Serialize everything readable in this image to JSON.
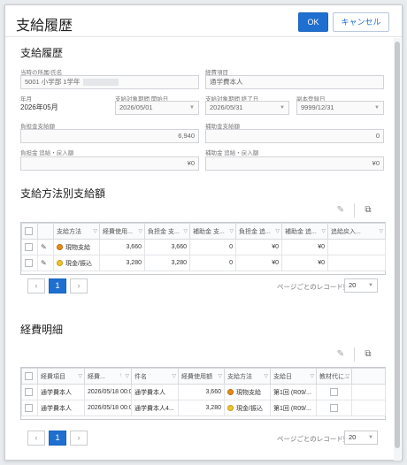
{
  "header": {
    "title": "支給履歴",
    "ok_label": "OK",
    "cancel_label": "キャンセル"
  },
  "summary": {
    "title": "支給履歴",
    "org_label": "当時の所属/氏名",
    "org_value": "5001 小学部 1学年",
    "expense_label": "経費項目",
    "expense_value": "通学費本人",
    "ym_label": "年月",
    "ym_value": "2026年05月",
    "start_label": "支給対象期間 開始日",
    "start_value": "2026/05/01",
    "end_label": "支給対象期間 終了日",
    "end_value": "2026/05/31",
    "revoke_label": "副本登録日",
    "revoke_value": "9999/12/31",
    "burden_label": "負担金支給額",
    "burden_value": "6,940",
    "subsidy_label": "補助金支給額",
    "subsidy_value": "0",
    "burden_refund_label": "負担金 追給・戻入額",
    "burden_refund_value": "¥0",
    "subsidy_refund_label": "補助金 追給・戻入額",
    "subsidy_refund_value": "¥0"
  },
  "methods": {
    "title": "支給方法別支給額",
    "columns": [
      "支給方法",
      "経費使用...",
      "負担金 支...",
      "補助金 支...",
      "負担金 追...",
      "補助金 追...",
      "追給戻入..."
    ],
    "rows": [
      {
        "method": "現物支給",
        "used": "3,660",
        "burden": "3,660",
        "subsidy": "0",
        "burden_ref": "¥0",
        "subsidy_ref": "¥0",
        "extra": ""
      },
      {
        "method": "現金/振込",
        "used": "3,280",
        "burden": "3,280",
        "subsidy": "0",
        "burden_ref": "¥0",
        "subsidy_ref": "¥0",
        "extra": ""
      }
    ],
    "pager": {
      "page": "1",
      "label": "ページごとのレコード数",
      "size": "20"
    }
  },
  "details": {
    "title": "経費明細",
    "columns": [
      "経費項目",
      "経費...",
      "件名",
      "経費使用額",
      "支給方法",
      "支給日",
      "教材代に..."
    ],
    "rows": [
      {
        "item": "通学費本人",
        "date": "2026/05/18 00:0",
        "subject": "通学費本人",
        "amount": "3,660",
        "method": "現物支給",
        "payday": "第1回 (R09/..."
      },
      {
        "item": "通学費本人",
        "date": "2026/05/18 00:0",
        "subject": "通学費本人4...",
        "amount": "3,280",
        "method": "現金/振込",
        "payday": "第1回 (R09/..."
      }
    ],
    "pager": {
      "page": "1",
      "label": "ページごとのレコード数",
      "size": "20"
    }
  },
  "icons": {
    "edit": "pencil-icon",
    "export": "export-icon",
    "filter": "filter-icon",
    "sort": "sort-icon"
  },
  "colors": {
    "accent": "#1e6fd0"
  }
}
